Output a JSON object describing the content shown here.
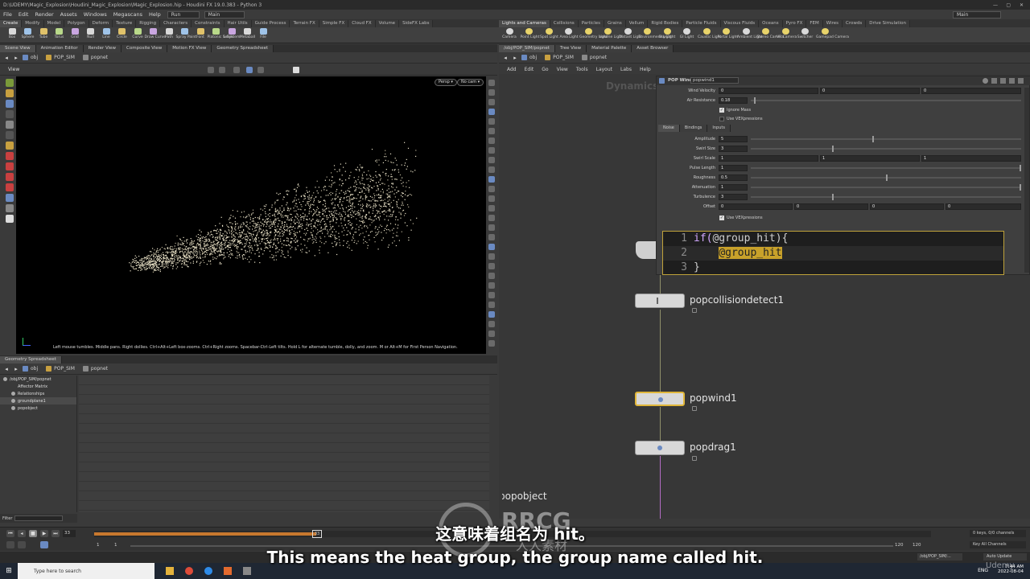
{
  "window": {
    "title": "D:\\UDEMY\\Magic_Explosion\\Houdini_Magic_Explosion\\Magic_Explosion.hip - Houdini FX 19.0.383 - Python 3",
    "min": "—",
    "max": "▢",
    "close": "✕"
  },
  "menubar": {
    "items": [
      "File",
      "Edit",
      "Render",
      "Assets",
      "Windows",
      "Megascans",
      "Help"
    ],
    "desktop": "Run",
    "layout": "Main",
    "right_layout": "Main"
  },
  "shelf_tabs_left": [
    "Create",
    "Modify",
    "Model",
    "Polygon",
    "Deform",
    "Texture",
    "Rigging",
    "Characters",
    "Constraints",
    "Hair Utils",
    "Guide Process",
    "Terrain FX",
    "Simple FX",
    "Cloud FX",
    "Volume",
    "SideFX Labs"
  ],
  "shelf_tabs_right": [
    "Lights and Cameras",
    "Collisions",
    "Particles",
    "Grains",
    "Vellum",
    "Rigid Bodies",
    "Particle Fluids",
    "Viscous Fluids",
    "Oceans",
    "Pyro FX",
    "FEM",
    "Wires",
    "Crowds",
    "Drive Simulation"
  ],
  "tools_left": [
    "Box",
    "Sphere",
    "Tube",
    "Torus",
    "Grid",
    "Null",
    "Line",
    "Circle",
    "Curve",
    "Draw Curve",
    "Path",
    "Spray Paint",
    "Font",
    "Platonic Solids",
    "L-System",
    "Metaball",
    "File"
  ],
  "tools_right": [
    "Camera",
    "Point Light",
    "Spot Light",
    "Area Light",
    "Geometry Light",
    "Volume Light",
    "Distant Light",
    "Environment Light",
    "Sky Light",
    "GI Light",
    "Caustic Light",
    "Portal Light",
    "Ambient Light",
    "Stereo Camera",
    "VR Camera",
    "Switcher",
    "Gamepad Camera"
  ],
  "left_pane": {
    "tabs": [
      "Scene View",
      "Animation Editor",
      "Render View",
      "Composite View",
      "Motion FX View",
      "Geometry Spreadsheet"
    ],
    "path": [
      "obj",
      "POP_SIM",
      "popnet"
    ],
    "view_label": "View",
    "persp": "Persp ▾",
    "cam": "No cam ▾",
    "hint": "Left mouse tumbles. Middle pans. Right dollies. Ctrl+Alt+Left box-zooms. Ctrl+Right zooms. Spacebar-Ctrl-Left tilts. Hold L for alternate tumble, dolly, and zoom.    M or Alt+M for First Person Navigation."
  },
  "spreadsheet": {
    "tab": "Geometry Spreadsheet",
    "path": [
      "obj",
      "POP_SIM",
      "popnet"
    ],
    "tree": [
      "/obj/POP_SIM/popnet",
      "Affector Matrix",
      "Relationships",
      "groundplane1",
      "popobject"
    ],
    "filter_label": "Filter"
  },
  "right_pane": {
    "tabs": [
      "/obj/POP_SIM/popnet",
      "Tree View",
      "Material Palette",
      "Asset Browser"
    ],
    "path": [
      "obj",
      "POP_SIM",
      "popnet"
    ],
    "menu": [
      "Add",
      "Edit",
      "Go",
      "View",
      "Tools",
      "Layout",
      "Labs",
      "Help"
    ],
    "context_label": "Dynamics"
  },
  "params": {
    "node_type": "POP Wind",
    "node_name": "popwind1",
    "wind_velocity_label": "Wind Velocity",
    "wind_velocity": [
      "0",
      "0",
      "0"
    ],
    "air_resistance_label": "Air Resistance",
    "air_resistance": "0.18",
    "ignore_mass": "Ignore Mass",
    "use_vex": "Use VEXpressions",
    "subtabs": [
      "Noise",
      "Bindings",
      "Inputs"
    ],
    "amplitude_label": "Amplitude",
    "amplitude": "5",
    "amplitude_level": 0.45,
    "swirl_size_label": "Swirl Size",
    "swirl_size": "3",
    "swirl_size_level": 0.3,
    "swirl_scale_label": "Swirl Scale",
    "swirl_scale": [
      "1",
      "1",
      "1"
    ],
    "pulse_length_label": "Pulse Length",
    "pulse_length": "1",
    "pulse_length_level": 1.0,
    "roughness_label": "Roughness",
    "roughness": "0.5",
    "roughness_level": 0.5,
    "attenuation_label": "Attenuation",
    "attenuation": "1",
    "attenuation_level": 1.0,
    "turbulence_label": "Turbulence",
    "turbulence": "3",
    "turbulence_level": 0.3,
    "offset_label": "Offset",
    "offset": [
      "0",
      "0",
      "0",
      "0"
    ],
    "use_vex2": "Use VEXpressions"
  },
  "code": {
    "lines": [
      {
        "num": "1",
        "pre": "if(",
        "hl": "",
        "text": "@group_hit){"
      },
      {
        "num": "2",
        "pre": "    ",
        "hl": "@group_hit",
        "text": ""
      },
      {
        "num": "3",
        "pre": "}",
        "hl": "",
        "text": ""
      }
    ]
  },
  "nodes": [
    "popcollisiondetect1",
    "popwind1",
    "popdrag1",
    "popobject"
  ],
  "timeline": {
    "frame": "33",
    "start": "1",
    "start2": "1",
    "end": "120",
    "end2": "120",
    "current_marker": "33",
    "keys": "0 keys, 0/0 channels",
    "key_all": "Key All Channels",
    "path": "/obj/POP_SIM/...",
    "auto_update": "Auto Update"
  },
  "taskbar": {
    "search": "Type here to search",
    "lang": "ENG",
    "time": "7:44 AM",
    "date": "2022-08-04"
  },
  "subtitles": {
    "cn": "这意味着组名为 hit。",
    "en": "This means the heat group, the group name called hit."
  },
  "watermark": {
    "brand": "RRCG",
    "sub": "人人素材",
    "udemy": "Udemy"
  }
}
